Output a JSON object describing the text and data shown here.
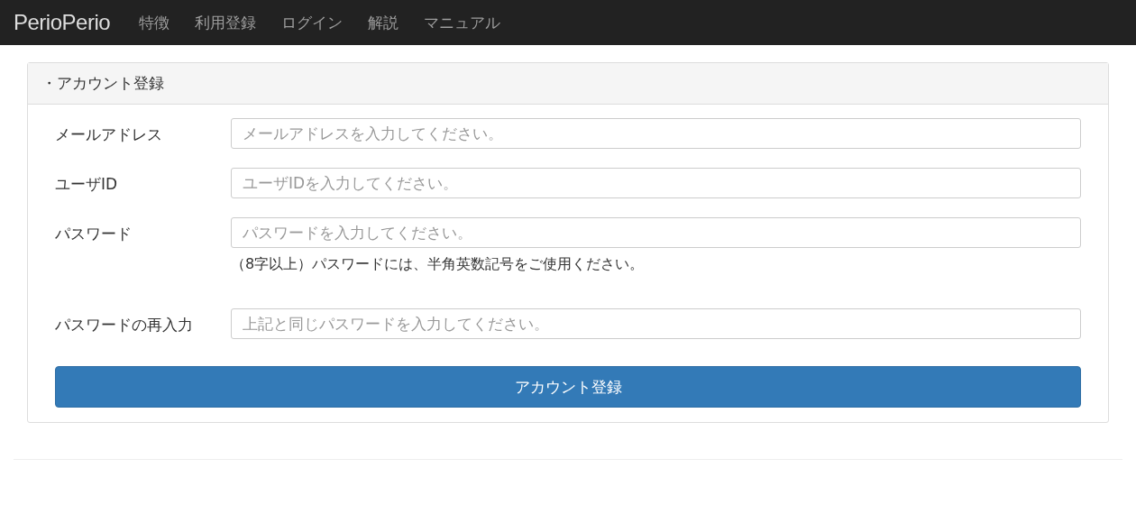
{
  "navbar": {
    "brand": "PerioPerio",
    "links": [
      {
        "label": "特徴"
      },
      {
        "label": "利用登録"
      },
      {
        "label": "ログイン"
      },
      {
        "label": "解説"
      },
      {
        "label": "マニュアル"
      }
    ]
  },
  "panel": {
    "title": "・アカウント登録",
    "fields": [
      {
        "label": "メールアドレス",
        "placeholder": "メールアドレスを入力してください。"
      },
      {
        "label": "ユーザID",
        "placeholder": "ユーザIDを入力してください。"
      },
      {
        "label": "パスワード",
        "placeholder": "パスワードを入力してください。",
        "help": "（8字以上）パスワードには、半角英数記号をご使用ください。"
      },
      {
        "label": "パスワードの再入力",
        "placeholder": "上記と同じパスワードを入力してください。"
      }
    ],
    "submit": "アカウント登録"
  }
}
